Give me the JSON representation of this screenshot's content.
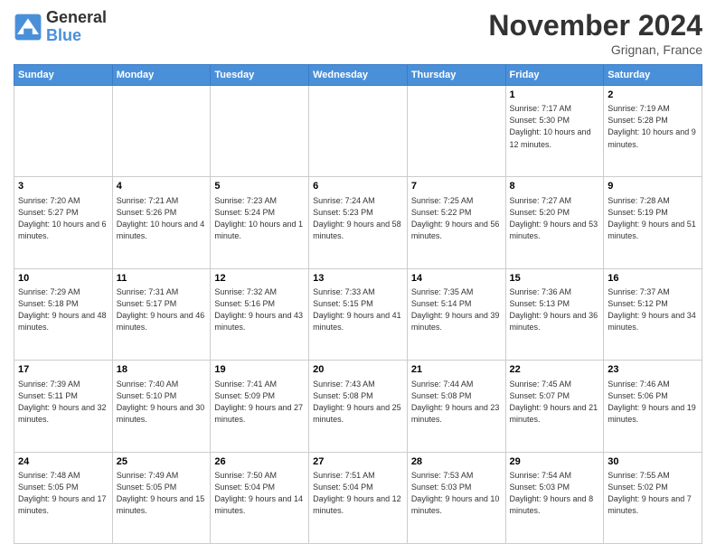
{
  "header": {
    "logo": {
      "general": "General",
      "blue": "Blue"
    },
    "title": "November 2024",
    "location": "Grignan, France"
  },
  "weekdays": [
    "Sunday",
    "Monday",
    "Tuesday",
    "Wednesday",
    "Thursday",
    "Friday",
    "Saturday"
  ],
  "weeks": [
    [
      {
        "day": "",
        "info": ""
      },
      {
        "day": "",
        "info": ""
      },
      {
        "day": "",
        "info": ""
      },
      {
        "day": "",
        "info": ""
      },
      {
        "day": "",
        "info": ""
      },
      {
        "day": "1",
        "info": "Sunrise: 7:17 AM\nSunset: 5:30 PM\nDaylight: 10 hours and 12 minutes."
      },
      {
        "day": "2",
        "info": "Sunrise: 7:19 AM\nSunset: 5:28 PM\nDaylight: 10 hours and 9 minutes."
      }
    ],
    [
      {
        "day": "3",
        "info": "Sunrise: 7:20 AM\nSunset: 5:27 PM\nDaylight: 10 hours and 6 minutes."
      },
      {
        "day": "4",
        "info": "Sunrise: 7:21 AM\nSunset: 5:26 PM\nDaylight: 10 hours and 4 minutes."
      },
      {
        "day": "5",
        "info": "Sunrise: 7:23 AM\nSunset: 5:24 PM\nDaylight: 10 hours and 1 minute."
      },
      {
        "day": "6",
        "info": "Sunrise: 7:24 AM\nSunset: 5:23 PM\nDaylight: 9 hours and 58 minutes."
      },
      {
        "day": "7",
        "info": "Sunrise: 7:25 AM\nSunset: 5:22 PM\nDaylight: 9 hours and 56 minutes."
      },
      {
        "day": "8",
        "info": "Sunrise: 7:27 AM\nSunset: 5:20 PM\nDaylight: 9 hours and 53 minutes."
      },
      {
        "day": "9",
        "info": "Sunrise: 7:28 AM\nSunset: 5:19 PM\nDaylight: 9 hours and 51 minutes."
      }
    ],
    [
      {
        "day": "10",
        "info": "Sunrise: 7:29 AM\nSunset: 5:18 PM\nDaylight: 9 hours and 48 minutes."
      },
      {
        "day": "11",
        "info": "Sunrise: 7:31 AM\nSunset: 5:17 PM\nDaylight: 9 hours and 46 minutes."
      },
      {
        "day": "12",
        "info": "Sunrise: 7:32 AM\nSunset: 5:16 PM\nDaylight: 9 hours and 43 minutes."
      },
      {
        "day": "13",
        "info": "Sunrise: 7:33 AM\nSunset: 5:15 PM\nDaylight: 9 hours and 41 minutes."
      },
      {
        "day": "14",
        "info": "Sunrise: 7:35 AM\nSunset: 5:14 PM\nDaylight: 9 hours and 39 minutes."
      },
      {
        "day": "15",
        "info": "Sunrise: 7:36 AM\nSunset: 5:13 PM\nDaylight: 9 hours and 36 minutes."
      },
      {
        "day": "16",
        "info": "Sunrise: 7:37 AM\nSunset: 5:12 PM\nDaylight: 9 hours and 34 minutes."
      }
    ],
    [
      {
        "day": "17",
        "info": "Sunrise: 7:39 AM\nSunset: 5:11 PM\nDaylight: 9 hours and 32 minutes."
      },
      {
        "day": "18",
        "info": "Sunrise: 7:40 AM\nSunset: 5:10 PM\nDaylight: 9 hours and 30 minutes."
      },
      {
        "day": "19",
        "info": "Sunrise: 7:41 AM\nSunset: 5:09 PM\nDaylight: 9 hours and 27 minutes."
      },
      {
        "day": "20",
        "info": "Sunrise: 7:43 AM\nSunset: 5:08 PM\nDaylight: 9 hours and 25 minutes."
      },
      {
        "day": "21",
        "info": "Sunrise: 7:44 AM\nSunset: 5:08 PM\nDaylight: 9 hours and 23 minutes."
      },
      {
        "day": "22",
        "info": "Sunrise: 7:45 AM\nSunset: 5:07 PM\nDaylight: 9 hours and 21 minutes."
      },
      {
        "day": "23",
        "info": "Sunrise: 7:46 AM\nSunset: 5:06 PM\nDaylight: 9 hours and 19 minutes."
      }
    ],
    [
      {
        "day": "24",
        "info": "Sunrise: 7:48 AM\nSunset: 5:05 PM\nDaylight: 9 hours and 17 minutes."
      },
      {
        "day": "25",
        "info": "Sunrise: 7:49 AM\nSunset: 5:05 PM\nDaylight: 9 hours and 15 minutes."
      },
      {
        "day": "26",
        "info": "Sunrise: 7:50 AM\nSunset: 5:04 PM\nDaylight: 9 hours and 14 minutes."
      },
      {
        "day": "27",
        "info": "Sunrise: 7:51 AM\nSunset: 5:04 PM\nDaylight: 9 hours and 12 minutes."
      },
      {
        "day": "28",
        "info": "Sunrise: 7:53 AM\nSunset: 5:03 PM\nDaylight: 9 hours and 10 minutes."
      },
      {
        "day": "29",
        "info": "Sunrise: 7:54 AM\nSunset: 5:03 PM\nDaylight: 9 hours and 8 minutes."
      },
      {
        "day": "30",
        "info": "Sunrise: 7:55 AM\nSunset: 5:02 PM\nDaylight: 9 hours and 7 minutes."
      }
    ]
  ]
}
